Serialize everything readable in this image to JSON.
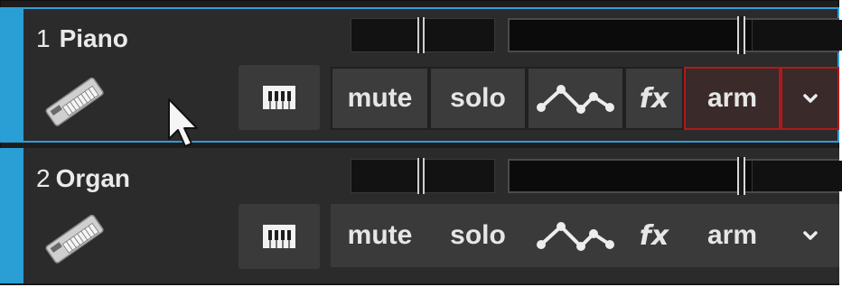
{
  "tracks": [
    {
      "number": "1",
      "name": "Piano",
      "buttons": {
        "mute": "mute",
        "solo": "solo",
        "fx": "fx",
        "arm": "arm"
      },
      "armed": true,
      "selected": true
    },
    {
      "number": "2",
      "name": "Organ",
      "buttons": {
        "mute": "mute",
        "solo": "solo",
        "fx": "fx",
        "arm": "arm"
      },
      "armed": false,
      "selected": false
    }
  ],
  "colors": {
    "track_color": "#2a9fd6",
    "arm_border": "#b0191b",
    "background": "#2b2b2b"
  },
  "icons": [
    "keyboard-icon",
    "instrument-icon",
    "automation-icon",
    "chevron-down-icon",
    "mouse-cursor-icon"
  ]
}
